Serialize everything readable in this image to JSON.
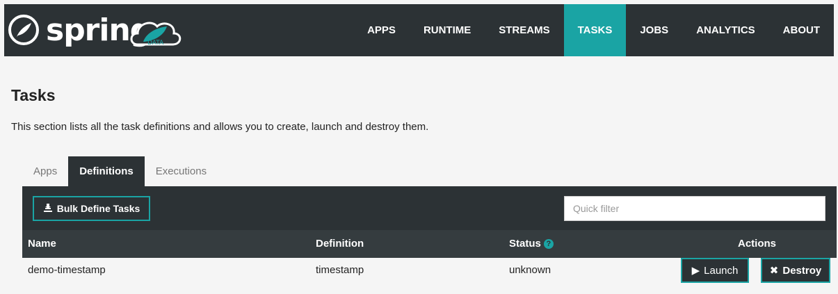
{
  "brand": {
    "name": "spring",
    "badge": "DATA"
  },
  "nav": {
    "items": [
      {
        "label": "APPS"
      },
      {
        "label": "RUNTIME"
      },
      {
        "label": "STREAMS"
      },
      {
        "label": "TASKS",
        "active": true
      },
      {
        "label": "JOBS"
      },
      {
        "label": "ANALYTICS"
      },
      {
        "label": "ABOUT"
      }
    ]
  },
  "page": {
    "title": "Tasks",
    "description": "This section lists all the task definitions and allows you to create, launch and destroy them."
  },
  "tabs": [
    {
      "label": "Apps"
    },
    {
      "label": "Definitions",
      "active": true
    },
    {
      "label": "Executions"
    }
  ],
  "toolbar": {
    "bulk_define_label": "Bulk Define Tasks",
    "quick_filter_placeholder": "Quick filter"
  },
  "table": {
    "headers": {
      "name": "Name",
      "definition": "Definition",
      "status": "Status",
      "actions": "Actions"
    },
    "rows": [
      {
        "name": "demo-timestamp",
        "definition": "timestamp",
        "status": "unknown",
        "launch": "Launch",
        "destroy": "Destroy"
      }
    ]
  },
  "colors": {
    "accent": "#1aa4a4",
    "dark": "#2c3235",
    "background": "#f5f5f5"
  },
  "icons": [
    "spring-logo-icon",
    "cloud-leaf-icon",
    "bulk-define-icon",
    "help-icon",
    "play-icon",
    "close-icon"
  ]
}
